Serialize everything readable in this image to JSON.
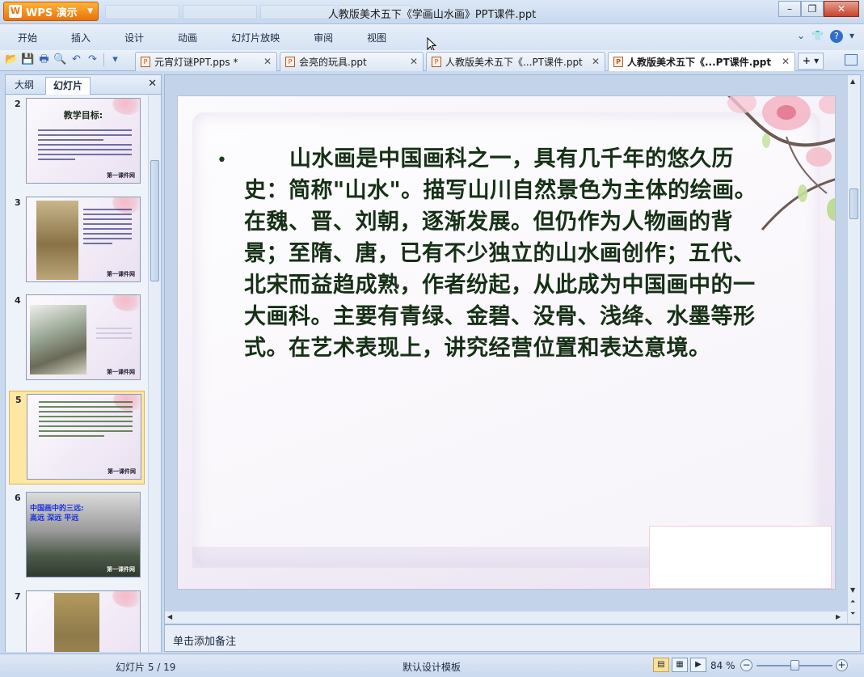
{
  "app": {
    "brand_label": "WPS 演示",
    "window_title": "人教版美术五下《学画山水画》PPT课件.ppt"
  },
  "menu": [
    "开始",
    "插入",
    "设计",
    "动画",
    "幻灯片放映",
    "审阅",
    "视图"
  ],
  "doc_tabs": [
    {
      "label": "元宵灯谜PPT.pps *",
      "active": false
    },
    {
      "label": "会亮的玩具.ppt",
      "active": false
    },
    {
      "label": "人教版美术五下《...PT课件.ppt",
      "active": false
    },
    {
      "label": "人教版美术五下《...PT课件.ppt",
      "active": true
    }
  ],
  "left_panel": {
    "tabs": [
      "大纲",
      "幻灯片"
    ],
    "active_tab": "幻灯片",
    "slides": [
      {
        "number": "2",
        "title": "教学目标:",
        "footer": "第一课件网"
      },
      {
        "number": "3",
        "footer": "第一课件网"
      },
      {
        "number": "4",
        "footer": "第一课件网"
      },
      {
        "number": "5",
        "footer": "第一课件网",
        "selected": true
      },
      {
        "number": "6",
        "caption_line1": "中国画中的三远:",
        "caption_line2": "高远 深远 平远",
        "footer": "第一课件网"
      },
      {
        "number": "7"
      }
    ]
  },
  "slide": {
    "bullet": "•",
    "text": "山水画是中国画科之一，具有几千年的悠久历史：简称\"山水\"。描写山川自然景色为主体的绘画。在魏、晋、刘朝，逐渐发展。但仍作为人物画的背景；至隋、唐，已有不少独立的山水画创作；五代、北宋而益趋成熟，作者纷起，从此成为中国画中的一大画科。主要有青绿、金碧、没骨、浅绛、水墨等形式。在艺术表现上，讲究经营位置和表达意境。"
  },
  "notes": {
    "placeholder": "单击添加备注"
  },
  "status": {
    "slide_position": "幻灯片 5 / 19",
    "template": "默认设计模板",
    "zoom": "84 %",
    "zoom_fraction": 0.5
  },
  "colors": {
    "accent": "#e8730a",
    "slide_text": "#163016",
    "chrome": "#c9d9ee"
  }
}
